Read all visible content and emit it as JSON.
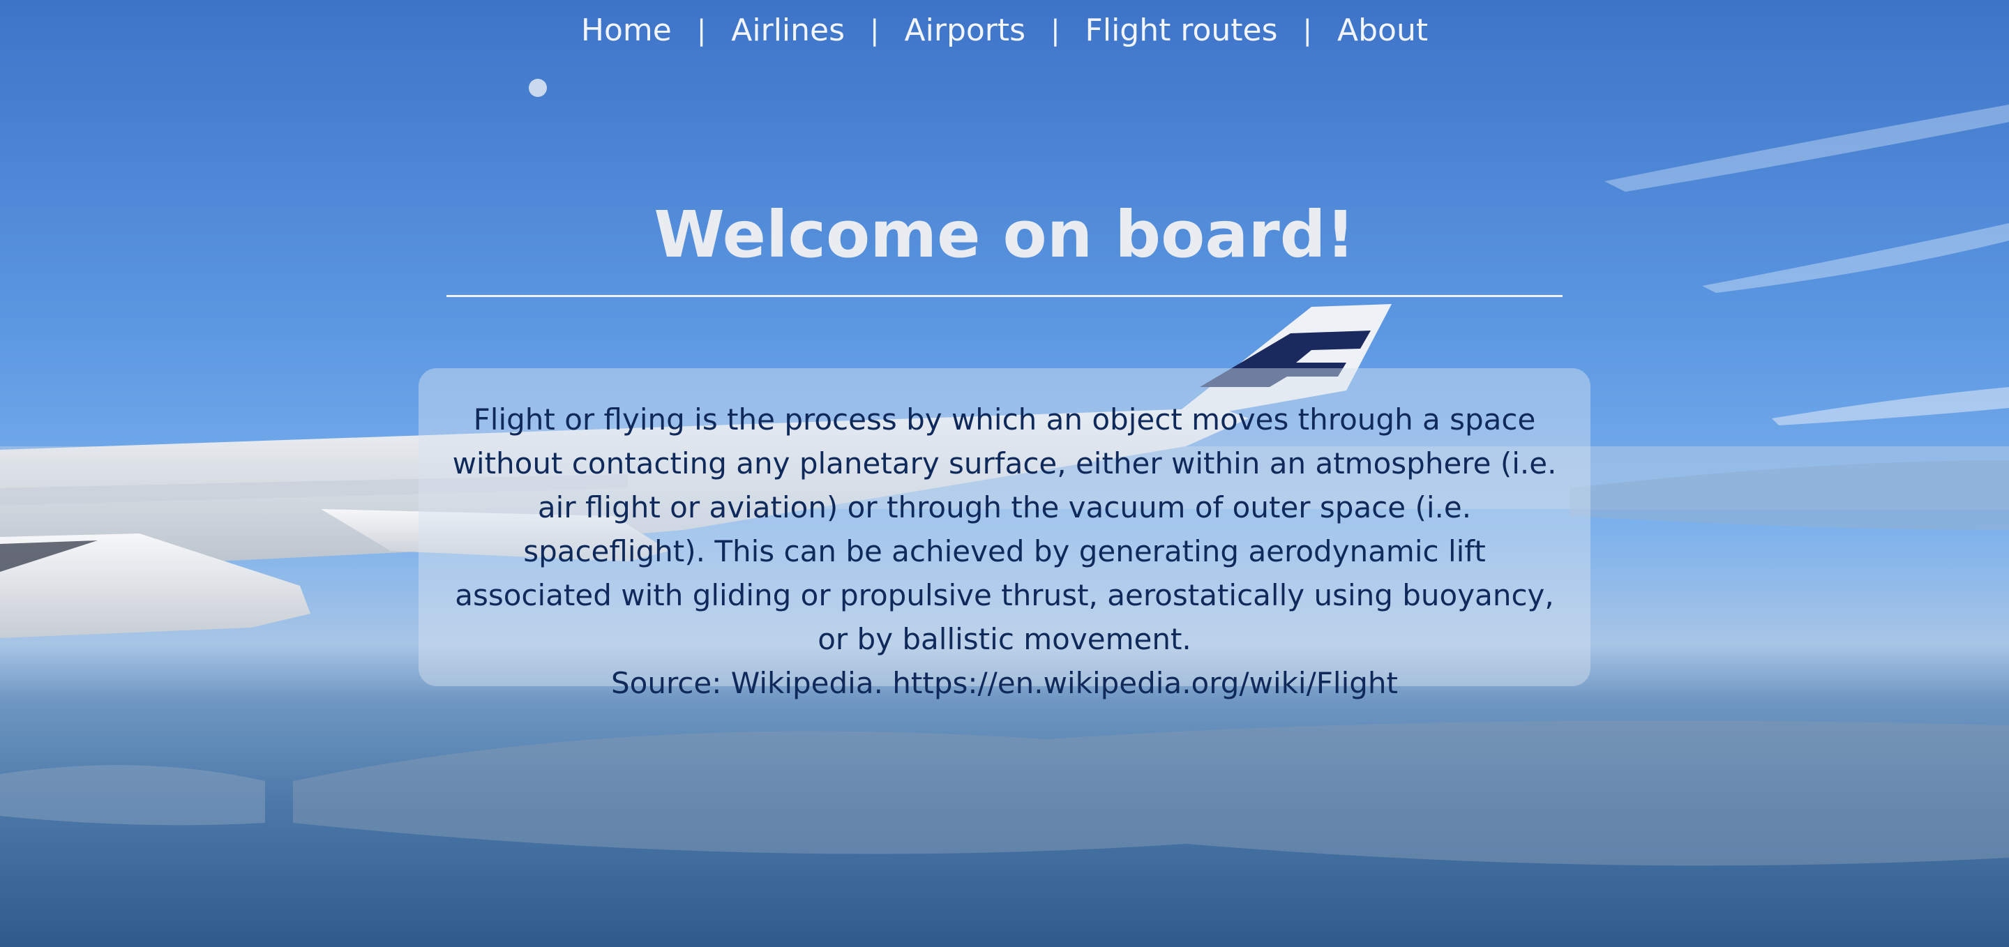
{
  "nav": {
    "items": [
      {
        "label": "Home"
      },
      {
        "label": "Airlines"
      },
      {
        "label": "Airports"
      },
      {
        "label": "Flight routes"
      },
      {
        "label": "About"
      }
    ],
    "separator": "|"
  },
  "hero": {
    "title": "Welcome on board!"
  },
  "intro": {
    "text": "Flight or flying is the process by which an object moves through a space without contacting any planetary surface, either within an atmosphere (i.e. air flight or aviation) or through the vacuum of outer space (i.e. spaceflight). This can be achieved by generating aerodynamic lift associated with gliding or propulsive thrust, aerostatically using buoyancy, or by ballistic movement.",
    "source": "Source: Wikipedia. https://en.wikipedia.org/wiki/Flight"
  },
  "colors": {
    "sky_top": "#3f78cc",
    "sky_mid": "#6aa6ea",
    "ground": "#3b6896",
    "title": "#e9ecf1",
    "card_text": "#0f2a5a",
    "tail_logo": "#1b2a5e"
  },
  "background": {
    "icon": "airplane-wing-sky-photo"
  }
}
